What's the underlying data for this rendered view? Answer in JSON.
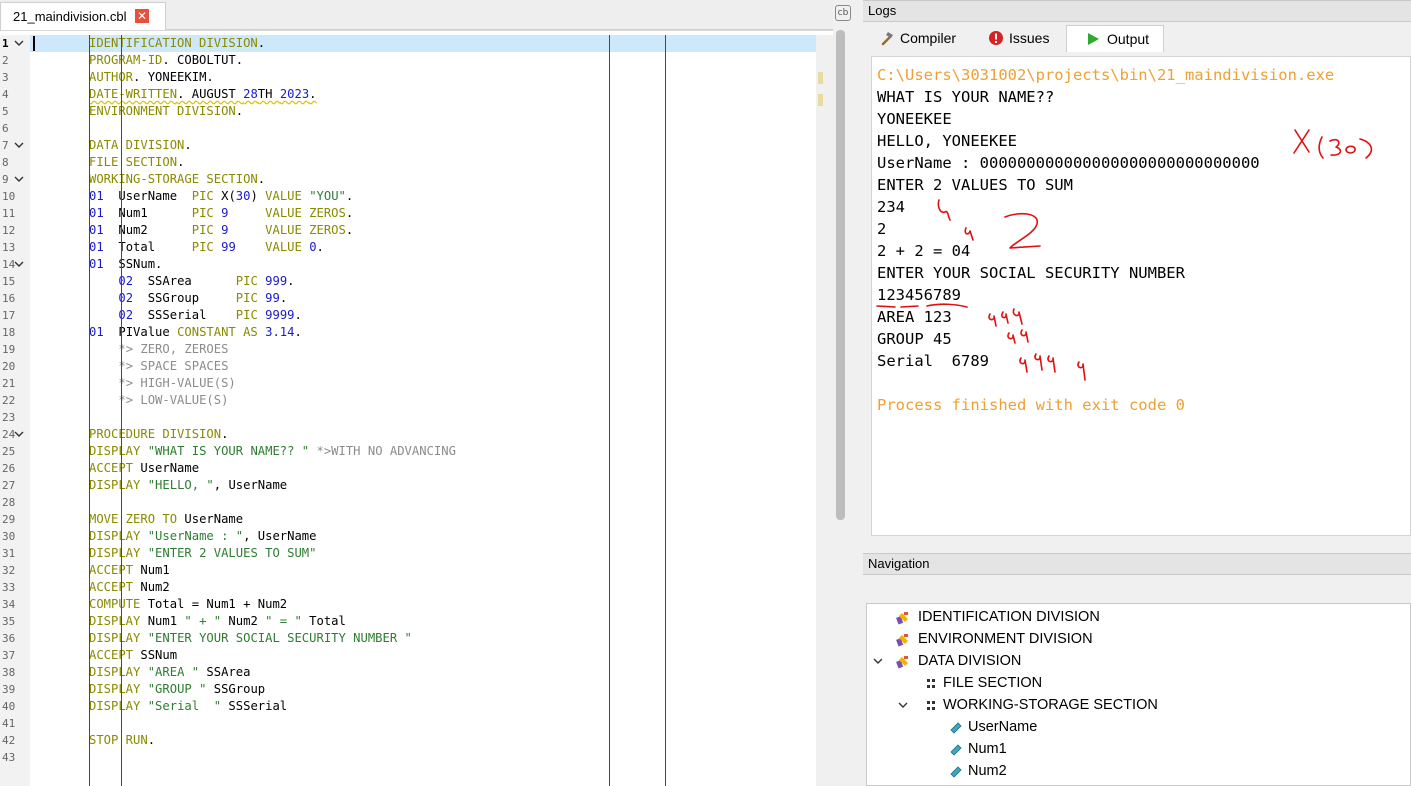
{
  "editor": {
    "tab": {
      "filename": "21_maindivision.cbl",
      "close": "✕"
    },
    "lines": [
      {
        "n": "1",
        "fold": true,
        "html": "<span class=\"kw\">IDENTIFICATION DIVISION</span>."
      },
      {
        "n": "2",
        "html": "<span class=\"kw\">PROGRAM-ID</span>. COBOLTUT."
      },
      {
        "n": "3",
        "html": "<span class=\"kw\">AUTHOR</span>. YONEEKIM."
      },
      {
        "n": "4",
        "html": "<span class=\"sq\"><span class=\"kw\">DATE-WRITTEN</span>. AUGUST <span class=\"num2\">28</span>TH <span class=\"num2\">2023</span>.</span>"
      },
      {
        "n": "5",
        "html": "<span class=\"kw\">ENVIRONMENT DIVISION</span>."
      },
      {
        "n": "6",
        "html": ""
      },
      {
        "n": "7",
        "fold": true,
        "html": "<span class=\"kw\">DATA DIVISION</span>."
      },
      {
        "n": "8",
        "html": "<span class=\"kw\">FILE SECTION</span>."
      },
      {
        "n": "9",
        "fold": true,
        "html": "<span class=\"kw\">WORKING-STORAGE SECTION</span>."
      },
      {
        "n": "10",
        "html": "<span class=\"num2\">01</span>  UserName  <span class=\"kw\">PIC</span> X(<span class=\"num2\">30</span>) <span class=\"kw\">VALUE</span> <span class=\"str\">\"YOU\"</span>."
      },
      {
        "n": "11",
        "html": "<span class=\"num2\">01</span>  Num1      <span class=\"kw\">PIC</span> <span class=\"num2\">9</span>     <span class=\"kw\">VALUE ZEROS</span>."
      },
      {
        "n": "12",
        "html": "<span class=\"num2\">01</span>  Num2      <span class=\"kw\">PIC</span> <span class=\"num2\">9</span>     <span class=\"kw\">VALUE ZEROS</span>."
      },
      {
        "n": "13",
        "html": "<span class=\"num2\">01</span>  Total     <span class=\"kw\">PIC</span> <span class=\"num2\">99</span>    <span class=\"kw\">VALUE</span> <span class=\"num2\">0</span>."
      },
      {
        "n": "14",
        "fold": true,
        "html": "<span class=\"num2\">01</span>  SSNum."
      },
      {
        "n": "15",
        "html": "    <span class=\"num2\">02</span>  SSArea      <span class=\"kw\">PIC</span> <span class=\"num2\">999</span>."
      },
      {
        "n": "16",
        "html": "    <span class=\"num2\">02</span>  SSGroup     <span class=\"kw\">PIC</span> <span class=\"num2\">99</span>."
      },
      {
        "n": "17",
        "html": "    <span class=\"num2\">02</span>  SSSerial    <span class=\"kw\">PIC</span> <span class=\"num2\">9999</span>."
      },
      {
        "n": "18",
        "html": "<span class=\"num2\">01</span>  PIValue <span class=\"kw\">CONSTANT AS</span> <span class=\"num2\">3.14</span>."
      },
      {
        "n": "19",
        "html": "    <span class=\"cmt\">*&gt; ZERO, ZEROES</span>"
      },
      {
        "n": "20",
        "html": "    <span class=\"cmt\">*&gt; SPACE SPACES</span>"
      },
      {
        "n": "21",
        "html": "    <span class=\"cmt\">*&gt; HIGH-VALUE(S)</span>"
      },
      {
        "n": "22",
        "html": "    <span class=\"cmt\">*&gt; LOW-VALUE(S)</span>"
      },
      {
        "n": "23",
        "html": ""
      },
      {
        "n": "24",
        "fold": true,
        "html": "<span class=\"kw\">PROCEDURE DIVISION</span>."
      },
      {
        "n": "25",
        "html": "<span class=\"kw\">DISPLAY</span> <span class=\"str\">\"WHAT IS YOUR NAME?? \"</span> <span class=\"cmt\">*&gt;WITH NO ADVANCING</span>"
      },
      {
        "n": "26",
        "html": "<span class=\"kw\">ACCEPT</span> UserName"
      },
      {
        "n": "27",
        "html": "<span class=\"kw\">DISPLAY</span> <span class=\"str\">\"HELLO, \"</span>, UserName"
      },
      {
        "n": "28",
        "html": ""
      },
      {
        "n": "29",
        "html": "<span class=\"kw\">MOVE ZERO TO</span> UserName"
      },
      {
        "n": "30",
        "html": "<span class=\"kw\">DISPLAY</span> <span class=\"str\">\"UserName : \"</span>, UserName"
      },
      {
        "n": "31",
        "html": "<span class=\"kw\">DISPLAY</span> <span class=\"str\">\"ENTER 2 VALUES TO SUM\"</span>"
      },
      {
        "n": "32",
        "html": "<span class=\"kw\">ACCEPT</span> Num1"
      },
      {
        "n": "33",
        "html": "<span class=\"kw\">ACCEPT</span> Num2"
      },
      {
        "n": "34",
        "html": "<span class=\"kw\">COMPUTE</span> Total = Num1 + Num2"
      },
      {
        "n": "35",
        "html": "<span class=\"kw\">DISPLAY</span> Num1 <span class=\"str\">\" + \"</span> Num2 <span class=\"str\">\" = \"</span> Total"
      },
      {
        "n": "36",
        "html": "<span class=\"kw\">DISPLAY</span> <span class=\"str\">\"ENTER YOUR SOCIAL SECURITY NUMBER \"</span>"
      },
      {
        "n": "37",
        "html": "<span class=\"kw\">ACCEPT</span> SSNum"
      },
      {
        "n": "38",
        "html": "<span class=\"kw\">DISPLAY</span> <span class=\"str\">\"AREA \"</span> SSArea"
      },
      {
        "n": "39",
        "html": "<span class=\"kw\">DISPLAY</span> <span class=\"str\">\"GROUP \"</span> SSGroup"
      },
      {
        "n": "40",
        "html": "<span class=\"kw\">DISPLAY</span> <span class=\"str\">\"Serial  \"</span> SSSerial"
      },
      {
        "n": "41",
        "html": ""
      },
      {
        "n": "42",
        "html": "<span class=\"kw\">STOP RUN</span>."
      },
      {
        "n": "43",
        "html": ""
      }
    ]
  },
  "logs": {
    "title": "Logs",
    "tabs": [
      {
        "label": "Compiler",
        "icon": "hammer-icon"
      },
      {
        "label": "Issues",
        "icon": "error-icon"
      },
      {
        "label": "Output",
        "icon": "play-icon",
        "active": true
      }
    ],
    "output_lines": [
      {
        "text": "C:\\Users\\3031002\\projects\\bin\\21_maindivision.exe",
        "color": "orange"
      },
      {
        "text": "WHAT IS YOUR NAME??"
      },
      {
        "text": "YONEEKEE"
      },
      {
        "text": "HELLO, YONEEKEE"
      },
      {
        "text": "UserName : 000000000000000000000000000000"
      },
      {
        "text": "ENTER 2 VALUES TO SUM"
      },
      {
        "text": "234"
      },
      {
        "text": "2"
      },
      {
        "text": "2 + 2 = 04"
      },
      {
        "text": "ENTER YOUR SOCIAL SECURITY NUMBER"
      },
      {
        "text": "123456789"
      },
      {
        "text": "AREA 123"
      },
      {
        "text": "GROUP 45"
      },
      {
        "text": "Serial  6789"
      },
      {
        "text": ""
      },
      {
        "text": "Process finished with exit code 0",
        "color": "orange"
      }
    ]
  },
  "navigation": {
    "title": "Navigation",
    "items": [
      {
        "label": "IDENTIFICATION DIVISION",
        "icon": "division-icon",
        "level": 0,
        "chevron": ""
      },
      {
        "label": "ENVIRONMENT DIVISION",
        "icon": "division-icon",
        "level": 0,
        "chevron": ""
      },
      {
        "label": "DATA DIVISION",
        "icon": "division-icon",
        "level": 0,
        "chevron": "v"
      },
      {
        "label": "FILE SECTION",
        "icon": "section-icon",
        "level": 1,
        "chevron": ""
      },
      {
        "label": "WORKING-STORAGE SECTION",
        "icon": "section-icon",
        "level": 1,
        "chevron": "v"
      },
      {
        "label": "UserName",
        "icon": "variable-icon",
        "level": 2,
        "chevron": ""
      },
      {
        "label": "Num1",
        "icon": "variable-icon",
        "level": 2,
        "chevron": ""
      },
      {
        "label": "Num2",
        "icon": "variable-icon",
        "level": 2,
        "chevron": ""
      }
    ]
  },
  "colors": {
    "keyword": "#8a8a00",
    "string": "#2e7d32",
    "number": "#1a1acc",
    "comment": "#8c8c8c",
    "orange_output": "#f0a030",
    "annotation_red": "#e01010"
  }
}
